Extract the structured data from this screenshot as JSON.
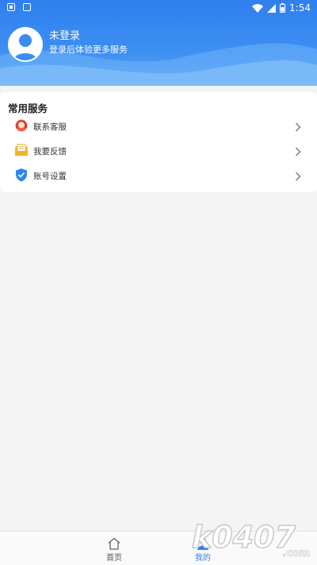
{
  "status_bar": {
    "time": "1:54"
  },
  "profile": {
    "name": "未登录",
    "subtitle": "登录后体验更多服务"
  },
  "services": {
    "title": "常用服务",
    "items": [
      {
        "label": "联系客服",
        "icon": "headset-icon"
      },
      {
        "label": "我要反馈",
        "icon": "feedback-envelope-icon"
      },
      {
        "label": "账号设置",
        "icon": "shield-check-icon"
      }
    ]
  },
  "bottom_nav": {
    "tabs": [
      {
        "label": "首页",
        "icon": "home-icon",
        "active": false
      },
      {
        "label": "我的",
        "icon": "user-icon",
        "active": true
      }
    ]
  },
  "watermark": {
    "text": "k0407.com"
  },
  "colors": {
    "brand_blue": "#2f7fef",
    "page_bg": "#f4f4f4"
  }
}
